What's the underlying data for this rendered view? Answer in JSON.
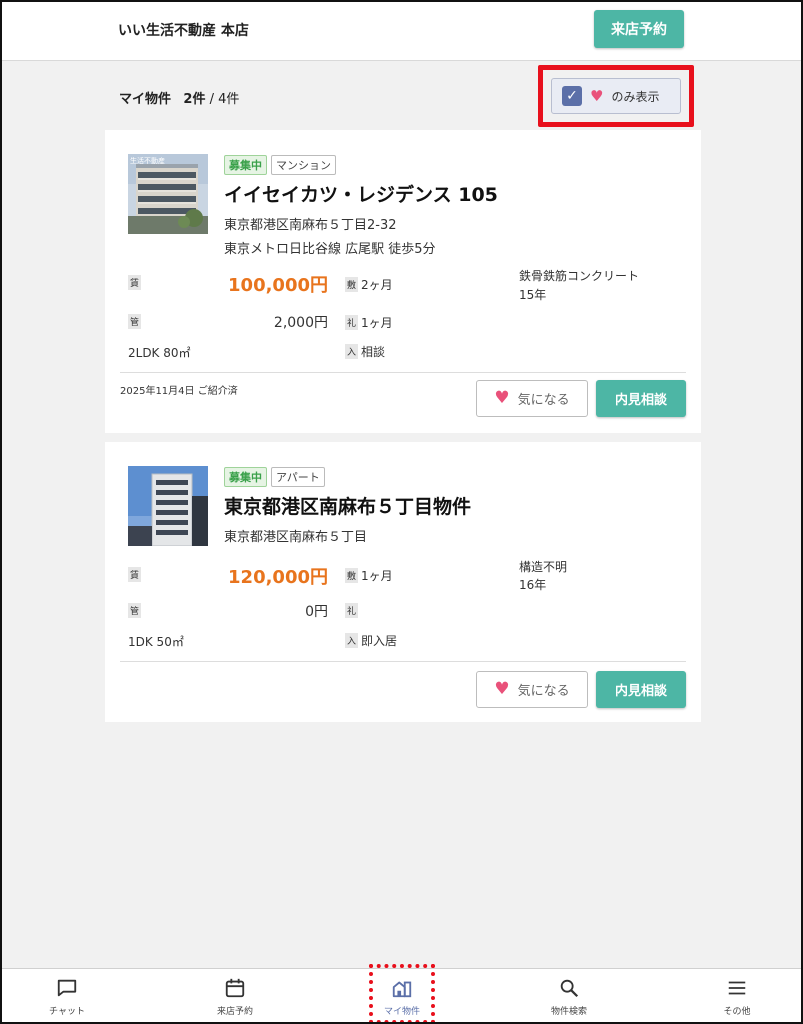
{
  "header": {
    "shop_name": "いい生活不動産 本店",
    "visit_button": "来店予約"
  },
  "list": {
    "title": "マイ物件",
    "count": "2件",
    "total": " / 4件",
    "filter_label": "のみ表示",
    "filter_checked": true
  },
  "properties": [
    {
      "badges": [
        "募集中",
        "マンション"
      ],
      "name": "イイセイカツ・レジデンス 105",
      "address": "東京都港区南麻布５丁目2-32",
      "access": "東京メトロ日比谷線 広尾駅 徒歩5分",
      "rent_tag": "賃",
      "rent": "100,000円",
      "mgmt_tag": "管",
      "mgmt_fee": "2,000円",
      "deposit_tag": "敷",
      "deposit": "2ヶ月",
      "key_money_tag": "礼",
      "key_money": "1ヶ月",
      "movein_tag": "入",
      "movein": "相談",
      "structure": "鉄骨鉄筋コンクリート",
      "age": "15年",
      "layout_area": "2LDK 80㎡",
      "date": "2025年11月4日 ご紹介済",
      "favorite_label": "気になる",
      "consult_label": "内見相談"
    },
    {
      "badges": [
        "募集中",
        "アパート"
      ],
      "name": "東京都港区南麻布５丁目物件",
      "address": "東京都港区南麻布５丁目",
      "access": "",
      "rent_tag": "賃",
      "rent": "120,000円",
      "mgmt_tag": "管",
      "mgmt_fee": "0円",
      "deposit_tag": "敷",
      "deposit": "1ヶ月",
      "key_money_tag": "礼",
      "key_money": "",
      "movein_tag": "入",
      "movein": "即入居",
      "structure": "構造不明",
      "age": "16年",
      "layout_area": "1DK 50㎡",
      "date": "",
      "favorite_label": "気になる",
      "consult_label": "内見相談"
    }
  ],
  "thumb_text": "生活不動産",
  "bottom_nav": [
    {
      "label": "チャット",
      "icon": "chat-icon"
    },
    {
      "label": "来店予約",
      "icon": "calendar-icon"
    },
    {
      "label": "マイ物件",
      "icon": "building-icon",
      "active": true
    },
    {
      "label": "物件検索",
      "icon": "search-icon"
    },
    {
      "label": "その他",
      "icon": "menu-icon"
    }
  ],
  "colors": {
    "accent_green": "#4db6a5",
    "rent_orange": "#e8741d",
    "heart_pink": "#e9517a",
    "active_nav": "#5b6fa8",
    "highlight_red": "#e8101c"
  }
}
